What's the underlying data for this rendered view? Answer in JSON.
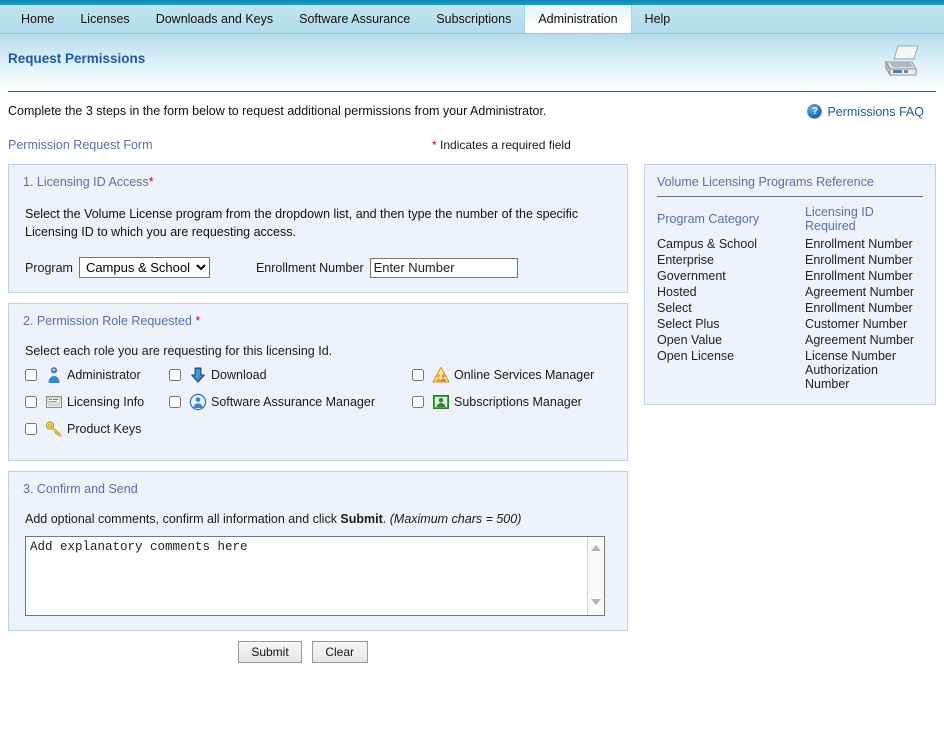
{
  "nav": {
    "items": [
      {
        "label": "Home",
        "active": false
      },
      {
        "label": "Licenses",
        "active": false
      },
      {
        "label": "Downloads and Keys",
        "active": false
      },
      {
        "label": "Software Assurance",
        "active": false
      },
      {
        "label": "Subscriptions",
        "active": false
      },
      {
        "label": "Administration",
        "active": true
      },
      {
        "label": "Help",
        "active": false
      }
    ]
  },
  "header": {
    "page_title": "Request Permissions",
    "print_icon": "printer-icon"
  },
  "intro": {
    "text": "Complete the 3 steps in the form below to request additional permissions from your Administrator.",
    "faq_label": "Permissions FAQ",
    "faq_icon": "question-mark-circle-icon",
    "form_label": "Permission Request Form",
    "required_note_star": "*",
    "required_note": " Indicates a required field"
  },
  "step1": {
    "title": "1. Licensing ID Access",
    "title_star": "*",
    "description": "Select the Volume License program from the dropdown list, and then type the number of the specific Licensing ID to which you are requesting access.",
    "program_label": "Program",
    "program_selected": "Campus & School",
    "program_options": [
      "Campus & School",
      "Enterprise",
      "Government",
      "Hosted",
      "Select",
      "Select Plus",
      "Open Value",
      "Open License"
    ],
    "enrollment_label": "Enrollment Number",
    "enrollment_value": "Enter Number",
    "enrollment_placeholder": "Enter Number"
  },
  "step2": {
    "title": "2. Permission Role Requested ",
    "title_star": "*",
    "instruction": "Select each role you are requesting for this licensing Id.",
    "roles": [
      {
        "label": "Administrator",
        "icon": "person-blue-icon",
        "checked": false,
        "col": "c1",
        "row": "r1"
      },
      {
        "label": "Licensing Info",
        "icon": "license-card-icon",
        "checked": false,
        "col": "c1",
        "row": "r2"
      },
      {
        "label": "Product Keys",
        "icon": "key-gold-icon",
        "checked": false,
        "col": "c1",
        "row": "r3"
      },
      {
        "label": "Download",
        "icon": "download-arrow-icon",
        "checked": false,
        "col": "c2",
        "row": "r1"
      },
      {
        "label": "Software Assurance Manager",
        "icon": "person-circle-icon",
        "checked": false,
        "col": "c2",
        "row": "r2"
      },
      {
        "label": "Online Services Manager",
        "icon": "online-services-icon",
        "checked": false,
        "col": "c3",
        "row": "r1"
      },
      {
        "label": "Subscriptions Manager",
        "icon": "subscriptions-card-icon",
        "checked": false,
        "col": "c3",
        "row": "r2"
      }
    ]
  },
  "step3": {
    "title": "3. Confirm and Send",
    "line_before": "Add optional comments, confirm all information and click ",
    "line_bold": "Submit",
    "line_after": ".",
    "line_italic": " (Maximum chars = 500)",
    "comments_value": "Add explanatory comments here",
    "comments_placeholder": "Add explanatory comments here",
    "scrollbar_up_icon": "chevron-up-icon",
    "scrollbar_down_icon": "chevron-down-icon"
  },
  "buttons": {
    "submit": "Submit",
    "clear": "Clear"
  },
  "reference": {
    "title": "Volume Licensing Programs Reference",
    "columns": [
      "Program Category",
      "Licensing ID Required"
    ],
    "rows": [
      {
        "category": "Campus & School",
        "id_required": "Enrollment Number",
        "id_required_2": ""
      },
      {
        "category": "Enterprise",
        "id_required": "Enrollment Number",
        "id_required_2": ""
      },
      {
        "category": "Government",
        "id_required": "Enrollment Number",
        "id_required_2": ""
      },
      {
        "category": "Hosted",
        "id_required": "Agreement Number",
        "id_required_2": ""
      },
      {
        "category": "Select",
        "id_required": "Enrollment Number",
        "id_required_2": ""
      },
      {
        "category": "Select Plus",
        "id_required": "Customer Number",
        "id_required_2": ""
      },
      {
        "category": "Open Value",
        "id_required": "Agreement Number",
        "id_required_2": ""
      },
      {
        "category": "Open License",
        "id_required": "License Number",
        "id_required_2": "Authorization Number"
      }
    ]
  },
  "colors": {
    "nav_bar": "#b9e0ee",
    "top_strip": "#1a9fcb",
    "title_blue": "#1d5ba6",
    "panel_bg": "#eef2fb",
    "panel_border": "#bcd2e8",
    "label_blue": "#5c6fa8",
    "required_red": "#d00000"
  }
}
